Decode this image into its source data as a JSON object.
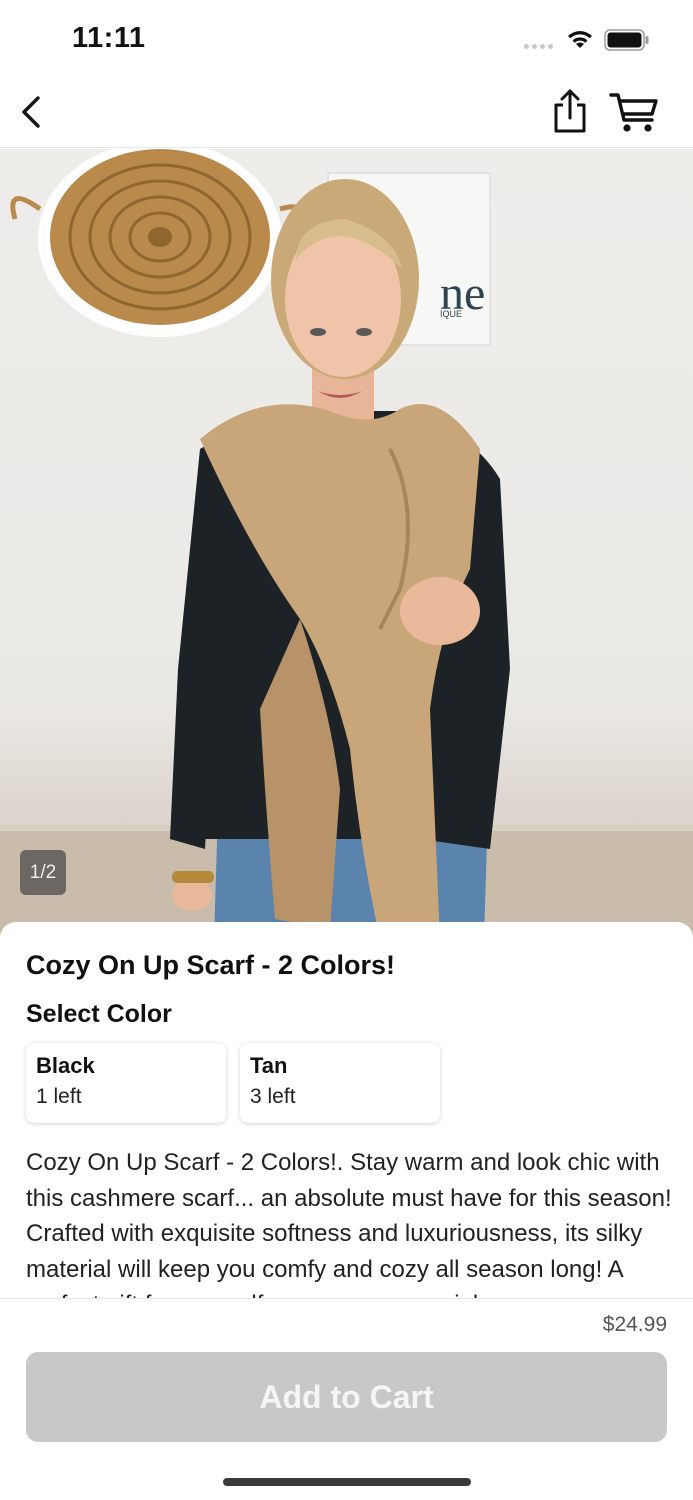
{
  "status_bar": {
    "time": "11:11"
  },
  "nav": {
    "back_icon": "chevron-left-icon",
    "share_icon": "share-icon",
    "cart_icon": "cart-icon"
  },
  "gallery": {
    "page_indicator": "1/2",
    "sign_text": "ne",
    "sign_subtext": "IQUE"
  },
  "product": {
    "title": "Cozy On Up Scarf - 2 Colors!",
    "select_color_label": "Select Color",
    "colors": [
      {
        "name": "Black",
        "stock": "1 left"
      },
      {
        "name": "Tan",
        "stock": "3 left"
      }
    ],
    "description": "Cozy On Up Scarf - 2 Colors!. Stay warm and look chic with this cashmere scarf... an absolute must have for this season! Crafted with exquisite softness and luxuriousness, its silky material will keep you comfy and cozy all season long! A perfect gift for yourself or someone special."
  },
  "footer": {
    "price": "$24.99",
    "add_to_cart": "Add to Cart"
  },
  "colors": {
    "button_disabled": "#c8c8c8",
    "scarf": "#c9a67a",
    "sweater": "#1c2226"
  }
}
